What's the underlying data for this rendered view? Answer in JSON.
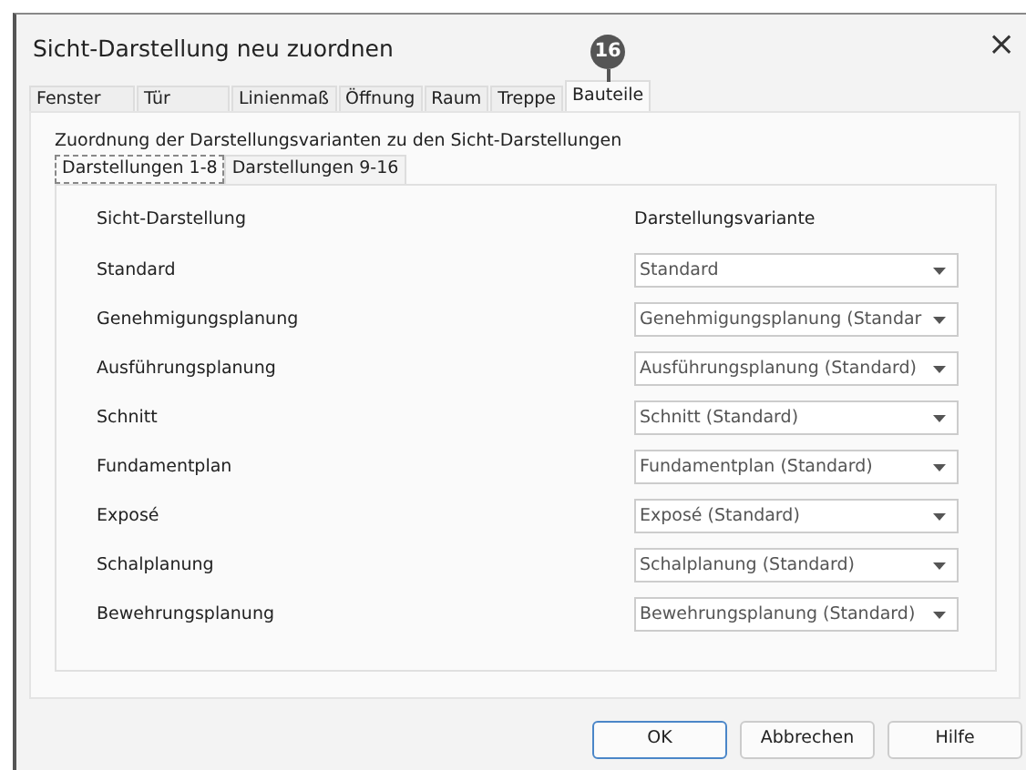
{
  "window": {
    "title": "Sicht-Darstellung neu zuordnen",
    "close": "×"
  },
  "tabs": [
    {
      "label": "Fenster",
      "selected": false
    },
    {
      "label": "Tür",
      "selected": false
    },
    {
      "label": "Linienmaß",
      "selected": false
    },
    {
      "label": "Öffnung",
      "selected": false
    },
    {
      "label": "Raum",
      "selected": false
    },
    {
      "label": "Treppe",
      "selected": false
    },
    {
      "label": "Bauteile",
      "selected": true
    }
  ],
  "callout": {
    "label": "16"
  },
  "description": "Zuordnung der Darstellungsvarianten zu den Sicht-Darstellungen",
  "subtabs": [
    {
      "label": "Darstellungen 1-8",
      "selected": true
    },
    {
      "label": "Darstellungen 9-16",
      "selected": false
    }
  ],
  "columns": [
    "Sicht-Darstellung",
    "Darstellungsvariante"
  ],
  "rows": [
    {
      "name": "Standard",
      "value": "Standard"
    },
    {
      "name": "Genehmigungsplanung",
      "value": "Genehmigungsplanung (Standar"
    },
    {
      "name": "Ausführungsplanung",
      "value": "Ausführungsplanung (Standard)"
    },
    {
      "name": "Schnitt",
      "value": "Schnitt (Standard)"
    },
    {
      "name": "Fundamentplan",
      "value": "Fundamentplan (Standard)"
    },
    {
      "name": "Exposé",
      "value": "Exposé (Standard)"
    },
    {
      "name": "Schalplanung",
      "value": "Schalplanung (Standard)"
    },
    {
      "name": "Bewehrungsplanung",
      "value": "Bewehrungsplanung (Standard)"
    }
  ],
  "buttons": [
    {
      "label": "OK",
      "default": true
    },
    {
      "label": "Abbrechen",
      "default": false
    },
    {
      "label": "Hilfe",
      "default": false
    }
  ]
}
